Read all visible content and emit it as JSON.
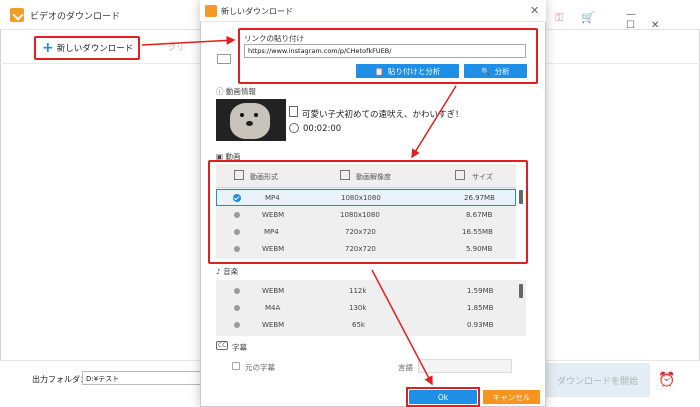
{
  "main": {
    "title": "ビデオのダウンロード",
    "new_download_label": "新しいダウンロード",
    "paste_faint": "クリ",
    "folder_label": "出力フォルダ：",
    "folder_value": "D:¥テスト",
    "start_label": "ダウンロードを開始"
  },
  "dialog": {
    "title": "新しいダウンロード",
    "link_label": "リンクの貼り付け",
    "link_value": "https://www.instagram.com/p/CHetofkFUEB/",
    "paste_analyze_label": "貼り付けと分析",
    "analyze_label": "分析",
    "info_header": "動画情報",
    "video_title": "可愛い子犬初めての遠吠え、かわいすぎ！",
    "duration": "00:02:00",
    "video_header": "動画",
    "columns": [
      "動画形式",
      "動画解像度",
      "サイズ"
    ],
    "video_rows": [
      {
        "format": "MP4",
        "resolution": "1080x1080",
        "size": "26.97MB",
        "selected": true
      },
      {
        "format": "WEBM",
        "resolution": "1080x1080",
        "size": "8.67MB",
        "selected": false
      },
      {
        "format": "MP4",
        "resolution": "720x720",
        "size": "16.55MB",
        "selected": false
      },
      {
        "format": "WEBM",
        "resolution": "720x720",
        "size": "5.90MB",
        "selected": false
      }
    ],
    "audio_header": "音楽",
    "audio_rows": [
      {
        "format": "WEBM",
        "bitrate": "112k",
        "size": "1.59MB"
      },
      {
        "format": "M4A",
        "bitrate": "130k",
        "size": "1.85MB"
      },
      {
        "format": "WEBM",
        "bitrate": "65k",
        "size": "0.93MB"
      }
    ],
    "subtitle_header": "字幕",
    "cc_label": "CC",
    "original_subtitle": "元の字幕",
    "language_label": "言語",
    "ok_label": "Ok",
    "cancel_label": "キャンセル"
  },
  "colors": {
    "accent": "#1e8ee6",
    "highlight": "#e02020",
    "cancel": "#f7931e"
  }
}
